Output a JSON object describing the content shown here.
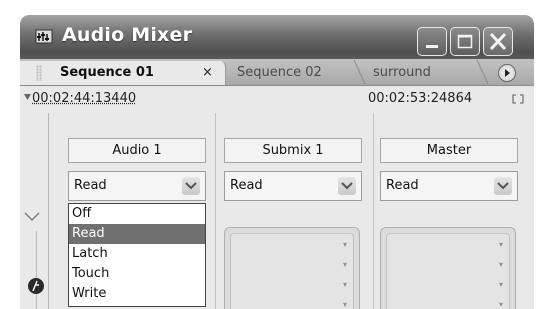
{
  "window": {
    "title": "Audio Mixer",
    "icons": [
      "audio-mixer-app-icon",
      "minimize-icon",
      "maximize-icon",
      "close-icon"
    ]
  },
  "tabs": [
    {
      "label": "Sequence 01",
      "active": true,
      "close_label": "×"
    },
    {
      "label": "Sequence 02",
      "active": false
    },
    {
      "label": "surround",
      "active": false
    }
  ],
  "timecode": {
    "current": "00:02:44:13440",
    "duration": "00:02:53:24864"
  },
  "tracks": [
    {
      "name": "Audio 1",
      "automation": "Read"
    },
    {
      "name": "Submix 1",
      "automation": "Read"
    },
    {
      "name": "Master",
      "automation": "Read"
    }
  ],
  "automation_menu": {
    "options": [
      "Off",
      "Read",
      "Latch",
      "Touch",
      "Write"
    ],
    "selected": "Read"
  },
  "colors": {
    "titlebar": "#5a5a5a",
    "panel": "#e9e9e9",
    "selection": "#707070"
  }
}
